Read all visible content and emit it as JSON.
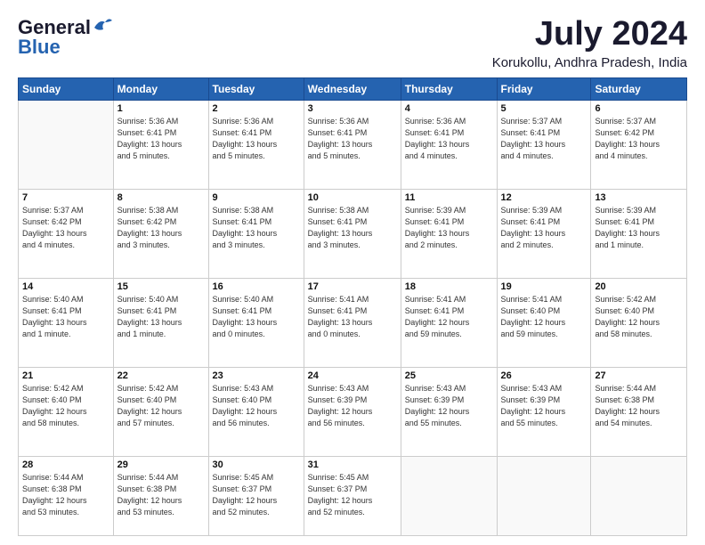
{
  "logo": {
    "line1": "General",
    "line2": "Blue"
  },
  "title": "July 2024",
  "location": "Korukollu, Andhra Pradesh, India",
  "days_of_week": [
    "Sunday",
    "Monday",
    "Tuesday",
    "Wednesday",
    "Thursday",
    "Friday",
    "Saturday"
  ],
  "weeks": [
    [
      {
        "day": "",
        "info": ""
      },
      {
        "day": "1",
        "info": "Sunrise: 5:36 AM\nSunset: 6:41 PM\nDaylight: 13 hours\nand 5 minutes."
      },
      {
        "day": "2",
        "info": "Sunrise: 5:36 AM\nSunset: 6:41 PM\nDaylight: 13 hours\nand 5 minutes."
      },
      {
        "day": "3",
        "info": "Sunrise: 5:36 AM\nSunset: 6:41 PM\nDaylight: 13 hours\nand 5 minutes."
      },
      {
        "day": "4",
        "info": "Sunrise: 5:36 AM\nSunset: 6:41 PM\nDaylight: 13 hours\nand 4 minutes."
      },
      {
        "day": "5",
        "info": "Sunrise: 5:37 AM\nSunset: 6:41 PM\nDaylight: 13 hours\nand 4 minutes."
      },
      {
        "day": "6",
        "info": "Sunrise: 5:37 AM\nSunset: 6:42 PM\nDaylight: 13 hours\nand 4 minutes."
      }
    ],
    [
      {
        "day": "7",
        "info": "Sunrise: 5:37 AM\nSunset: 6:42 PM\nDaylight: 13 hours\nand 4 minutes."
      },
      {
        "day": "8",
        "info": "Sunrise: 5:38 AM\nSunset: 6:42 PM\nDaylight: 13 hours\nand 3 minutes."
      },
      {
        "day": "9",
        "info": "Sunrise: 5:38 AM\nSunset: 6:41 PM\nDaylight: 13 hours\nand 3 minutes."
      },
      {
        "day": "10",
        "info": "Sunrise: 5:38 AM\nSunset: 6:41 PM\nDaylight: 13 hours\nand 3 minutes."
      },
      {
        "day": "11",
        "info": "Sunrise: 5:39 AM\nSunset: 6:41 PM\nDaylight: 13 hours\nand 2 minutes."
      },
      {
        "day": "12",
        "info": "Sunrise: 5:39 AM\nSunset: 6:41 PM\nDaylight: 13 hours\nand 2 minutes."
      },
      {
        "day": "13",
        "info": "Sunrise: 5:39 AM\nSunset: 6:41 PM\nDaylight: 13 hours\nand 1 minute."
      }
    ],
    [
      {
        "day": "14",
        "info": "Sunrise: 5:40 AM\nSunset: 6:41 PM\nDaylight: 13 hours\nand 1 minute."
      },
      {
        "day": "15",
        "info": "Sunrise: 5:40 AM\nSunset: 6:41 PM\nDaylight: 13 hours\nand 1 minute."
      },
      {
        "day": "16",
        "info": "Sunrise: 5:40 AM\nSunset: 6:41 PM\nDaylight: 13 hours\nand 0 minutes."
      },
      {
        "day": "17",
        "info": "Sunrise: 5:41 AM\nSunset: 6:41 PM\nDaylight: 13 hours\nand 0 minutes."
      },
      {
        "day": "18",
        "info": "Sunrise: 5:41 AM\nSunset: 6:41 PM\nDaylight: 12 hours\nand 59 minutes."
      },
      {
        "day": "19",
        "info": "Sunrise: 5:41 AM\nSunset: 6:40 PM\nDaylight: 12 hours\nand 59 minutes."
      },
      {
        "day": "20",
        "info": "Sunrise: 5:42 AM\nSunset: 6:40 PM\nDaylight: 12 hours\nand 58 minutes."
      }
    ],
    [
      {
        "day": "21",
        "info": "Sunrise: 5:42 AM\nSunset: 6:40 PM\nDaylight: 12 hours\nand 58 minutes."
      },
      {
        "day": "22",
        "info": "Sunrise: 5:42 AM\nSunset: 6:40 PM\nDaylight: 12 hours\nand 57 minutes."
      },
      {
        "day": "23",
        "info": "Sunrise: 5:43 AM\nSunset: 6:40 PM\nDaylight: 12 hours\nand 56 minutes."
      },
      {
        "day": "24",
        "info": "Sunrise: 5:43 AM\nSunset: 6:39 PM\nDaylight: 12 hours\nand 56 minutes."
      },
      {
        "day": "25",
        "info": "Sunrise: 5:43 AM\nSunset: 6:39 PM\nDaylight: 12 hours\nand 55 minutes."
      },
      {
        "day": "26",
        "info": "Sunrise: 5:43 AM\nSunset: 6:39 PM\nDaylight: 12 hours\nand 55 minutes."
      },
      {
        "day": "27",
        "info": "Sunrise: 5:44 AM\nSunset: 6:38 PM\nDaylight: 12 hours\nand 54 minutes."
      }
    ],
    [
      {
        "day": "28",
        "info": "Sunrise: 5:44 AM\nSunset: 6:38 PM\nDaylight: 12 hours\nand 53 minutes."
      },
      {
        "day": "29",
        "info": "Sunrise: 5:44 AM\nSunset: 6:38 PM\nDaylight: 12 hours\nand 53 minutes."
      },
      {
        "day": "30",
        "info": "Sunrise: 5:45 AM\nSunset: 6:37 PM\nDaylight: 12 hours\nand 52 minutes."
      },
      {
        "day": "31",
        "info": "Sunrise: 5:45 AM\nSunset: 6:37 PM\nDaylight: 12 hours\nand 52 minutes."
      },
      {
        "day": "",
        "info": ""
      },
      {
        "day": "",
        "info": ""
      },
      {
        "day": "",
        "info": ""
      }
    ]
  ]
}
